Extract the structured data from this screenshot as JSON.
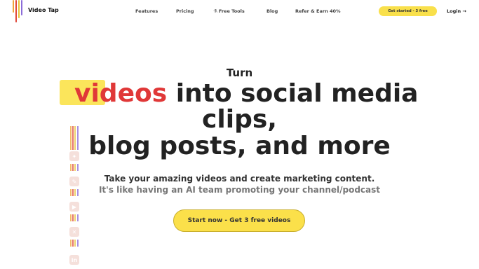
{
  "nav": {
    "brand": "Video Tap",
    "links": [
      {
        "label": "Features"
      },
      {
        "label": "Pricing"
      },
      {
        "label": "Free Tools",
        "icon": "flask-icon"
      },
      {
        "label": "Blog"
      },
      {
        "label": "Refer & Earn 40%"
      }
    ],
    "cta_label": "Get started - 3 free",
    "login_label": "Login →"
  },
  "hero": {
    "turn": "Turn",
    "highlight_word": "videos",
    "line1_rest": " into social media",
    "line2": "clips,",
    "line3": "blog posts, and more",
    "subtitle1": "Take your amazing videos and create marketing content.",
    "subtitle2": "It's like having an AI team promoting your channel/podcast",
    "cta_label": "Start now - Get 3 free videos"
  },
  "colors": {
    "accent_yellow": "#f9e04b",
    "accent_red": "#e03838",
    "stripe_orange": "#f0a53a",
    "stripe_red": "#e0483a",
    "stripe_purple": "#8b6cd8"
  },
  "strip_icons": [
    "twitter-icon",
    "blog-icon",
    "youtube-icon",
    "x-icon",
    "linkedin-icon"
  ]
}
